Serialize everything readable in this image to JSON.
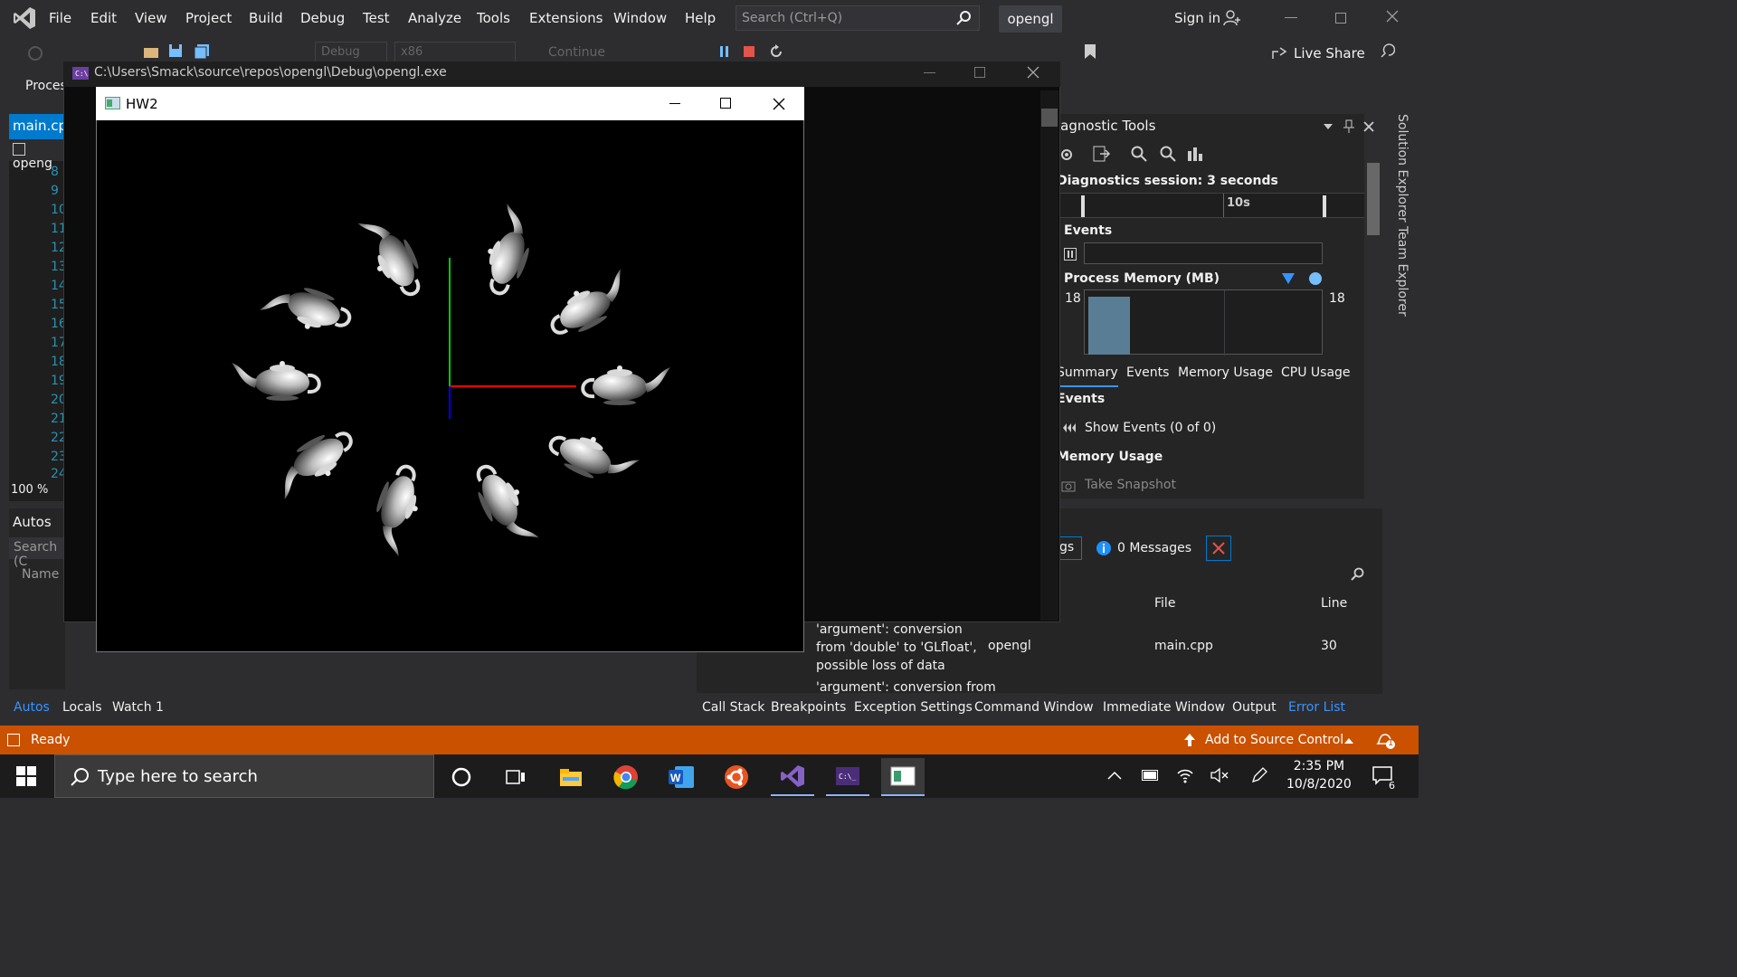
{
  "menu": {
    "items": [
      "File",
      "Edit",
      "View",
      "Project",
      "Build",
      "Debug",
      "Test",
      "Analyze",
      "Tools",
      "Extensions",
      "Window",
      "Help"
    ],
    "search_placeholder": "Search (Ctrl+Q)",
    "solution_name": "opengl",
    "sign_in": "Sign in"
  },
  "toolbar": {
    "config": "Debug",
    "platform": "x86",
    "continue": "Continue",
    "process_label": "Proces",
    "live_share": "Live Share"
  },
  "editor": {
    "tab": "main.cpp",
    "project_dropdown": "openg",
    "line_numbers": [
      "8",
      "9",
      "10",
      "11",
      "12",
      "13",
      "14",
      "15",
      "16",
      "17",
      "18",
      "19",
      "20",
      "21",
      "22",
      "23",
      "24"
    ],
    "zoom": "100 %"
  },
  "autos": {
    "title": "Autos",
    "search": "Search (C",
    "name_col": "Name"
  },
  "bottom_tabs_left": [
    "Autos",
    "Locals",
    "Watch 1"
  ],
  "bottom_tabs_right": [
    "Call Stack",
    "Breakpoints",
    "Exception Settings",
    "Command Window",
    "Immediate Window",
    "Output",
    "Error List"
  ],
  "console": {
    "path": "C:\\Users\\Smack\\source\\repos\\opengl\\Debug\\opengl.exe"
  },
  "gl_window": {
    "title": "HW2"
  },
  "diagnostics": {
    "title": "iagnostic Tools",
    "session": "Diagnostics session: 3 seconds",
    "ruler_label": "10s",
    "events": "Events",
    "process_memory": "Process Memory (MB)",
    "pm_min": "18",
    "pm_max": "18",
    "tabs": [
      "Summary",
      "Events",
      "Memory Usage",
      "CPU Usage"
    ],
    "events_section": "Events",
    "show_events": "Show Events (0 of 0)",
    "memory_section": "Memory Usage",
    "take_snapshot": "Take Snapshot"
  },
  "error_list": {
    "filter_label": "gs",
    "messages": "0 Messages",
    "col_file": "File",
    "col_line": "Line",
    "row1_desc": "'argument': conversion from 'double' to 'GLfloat', possible loss of data",
    "row1_project": "opengl",
    "row1_file": "main.cpp",
    "row1_line": "30",
    "row2_desc": "'argument': conversion from"
  },
  "statusbar": {
    "state": "Ready",
    "source_control": "Add to Source Control",
    "notif_count": "1"
  },
  "taskbar": {
    "search": "Type here to search",
    "time": "2:35 PM",
    "date": "10/8/2020",
    "notif": "6"
  },
  "colors": {
    "accent": "#007acc",
    "status": "#ca5100",
    "axis_x": "#ff0000",
    "axis_y": "#00cc00",
    "axis_z": "#0000ff"
  }
}
